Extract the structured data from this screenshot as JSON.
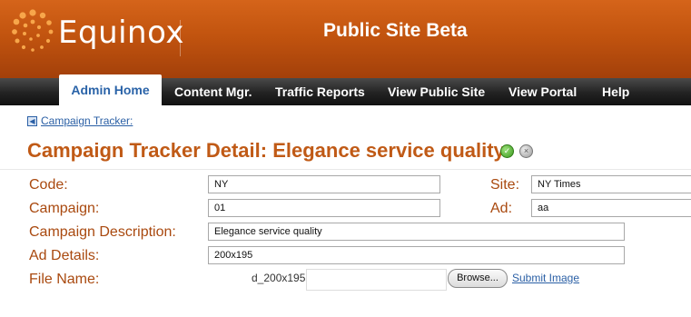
{
  "header": {
    "logo_text": "Equinox",
    "site_title": "Public Site Beta",
    "brand_color": "#c2540f"
  },
  "nav": {
    "items": [
      {
        "label": "Admin Home",
        "active": true
      },
      {
        "label": "Content Mgr."
      },
      {
        "label": "Traffic Reports"
      },
      {
        "label": "View Public Site"
      },
      {
        "label": "View Portal"
      },
      {
        "label": "Help"
      }
    ]
  },
  "breadcrumb": {
    "icon": "back-arrow-icon",
    "link": "Campaign Tracker:"
  },
  "page": {
    "title": "Campaign Tracker Detail: Elegance service quality",
    "title_color": "#c05a16",
    "icons": [
      "ok-icon",
      "cancel-icon"
    ]
  },
  "form": {
    "code": {
      "label": "Code:",
      "value": "NY"
    },
    "site": {
      "label": "Site:",
      "value": "NY Times"
    },
    "campaign": {
      "label": "Campaign:",
      "value": "01"
    },
    "ad": {
      "label": "Ad:",
      "value": "aa"
    },
    "campaign_description": {
      "label": "Campaign Description:",
      "value": "Elegance service quality"
    },
    "ad_details": {
      "label": "Ad Details:",
      "value": "200x195"
    },
    "file_name": {
      "label": "File Name:",
      "value": "d_200x195",
      "browse_label": "Browse...",
      "submit_label": "Submit Image"
    }
  }
}
